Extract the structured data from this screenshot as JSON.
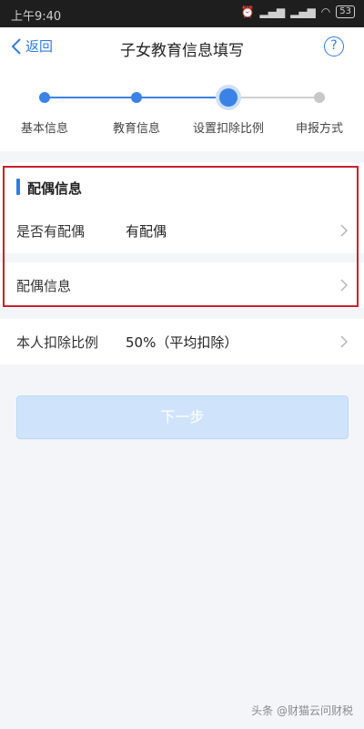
{
  "status_bar": {
    "time": "上午9:40",
    "battery": "53",
    "icons": [
      "alarm-icon",
      "signal-icon",
      "signal-icon",
      "wifi-icon",
      "battery-icon"
    ]
  },
  "nav": {
    "back_label": "返回",
    "title": "子女教育信息填写",
    "help_label": "?"
  },
  "steps": [
    {
      "label": "基本信息",
      "state": "done"
    },
    {
      "label": "教育信息",
      "state": "done"
    },
    {
      "label": "设置扣除比例",
      "state": "current"
    },
    {
      "label": "申报方式",
      "state": "pending"
    }
  ],
  "spouse_section": {
    "title": "配偶信息",
    "rows": [
      {
        "label": "是否有配偶",
        "value": "有配偶"
      },
      {
        "label": "配偶信息",
        "value": ""
      }
    ]
  },
  "deduction_row": {
    "label": "本人扣除比例",
    "value": "50%（平均扣除）"
  },
  "next_button": {
    "label": "下一步"
  },
  "watermark": "头条 @财猫云问财税",
  "colors": {
    "accent": "#2f7de1",
    "highlight_border": "#c8212e",
    "disabled_button": "#cfe4fb",
    "background": "#f3f5f8"
  }
}
